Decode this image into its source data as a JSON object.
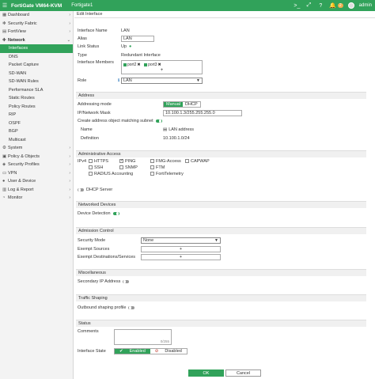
{
  "topbar": {
    "brand": "FortiGate VM64-KVM",
    "hostname": "Fortigate1",
    "notification_count": "2",
    "user": "admin"
  },
  "sidebar": {
    "items": [
      {
        "label": "Dashboard",
        "icon": "dashboard-icon",
        "chevron": "›"
      },
      {
        "label": "Security Fabric",
        "icon": "fabric-icon",
        "chevron": "›"
      },
      {
        "label": "FortiView",
        "icon": "fortiview-icon",
        "chevron": "›"
      },
      {
        "label": "Network",
        "icon": "network-icon",
        "chevron": "⌄"
      }
    ],
    "network_sub": [
      "Interfaces",
      "DNS",
      "Packet Capture",
      "SD-WAN",
      "SD-WAN Rules",
      "Performance SLA",
      "Static Routes",
      "Policy Routes",
      "RIP",
      "OSPF",
      "BGP",
      "Multicast"
    ],
    "items2": [
      {
        "label": "System",
        "icon": "system-icon",
        "chevron": "›",
        "badge": "1"
      },
      {
        "label": "Policy & Objects",
        "icon": "policy-icon",
        "chevron": "›"
      },
      {
        "label": "Security Profiles",
        "icon": "security-icon",
        "chevron": "›"
      },
      {
        "label": "VPN",
        "icon": "vpn-icon",
        "chevron": "›"
      },
      {
        "label": "User & Device",
        "icon": "user-icon",
        "chevron": "›"
      },
      {
        "label": "Log & Report",
        "icon": "log-icon",
        "chevron": "›"
      },
      {
        "label": "Monitor",
        "icon": "monitor-icon",
        "chevron": "›"
      }
    ]
  },
  "page_title": "Edit Interface",
  "form": {
    "interface_name_label": "Interface Name",
    "interface_name": "LAN",
    "alias_label": "Alias",
    "alias": "LAN",
    "link_status_label": "Link Status",
    "link_status": "Up",
    "type_label": "Type",
    "type": "Redundant Interface",
    "members_label": "Interface Members",
    "members": [
      "port2",
      "port3"
    ],
    "add_symbol": "+",
    "role_label": "Role",
    "role": "LAN"
  },
  "address": {
    "section": "Address",
    "mode_label": "Addressing mode",
    "mode_manual": "Manual",
    "mode_dhcp": "DHCP",
    "ip_label": "IP/Network Mask",
    "ip": "10.100.1.3/255.255.255.0",
    "create_label": "Create address object matching subnet",
    "name_label": "Name",
    "name": "LAN address",
    "definition_label": "Definition",
    "definition": "10.100.1.0/24"
  },
  "admin_access": {
    "section": "Administrative Access",
    "ipv4_label": "IPv4",
    "options": [
      {
        "label": "HTTPS",
        "checked": false
      },
      {
        "label": "PING",
        "checked": true
      },
      {
        "label": "FMG-Access",
        "checked": false
      },
      {
        "label": "CAPWAP",
        "checked": false
      },
      {
        "label": "SSH",
        "checked": false
      },
      {
        "label": "SNMP",
        "checked": false
      },
      {
        "label": "FTM",
        "checked": false
      },
      {
        "label": "RADIUS Accounting",
        "checked": false
      },
      {
        "label": "FortiTelemetry",
        "checked": false
      }
    ]
  },
  "dhcp_server": "DHCP Server",
  "networked_devices": {
    "section": "Networked Devices",
    "detection_label": "Device Detection"
  },
  "admission": {
    "section": "Admission Control",
    "mode_label": "Security Mode",
    "mode": "None",
    "exempt_sources_label": "Exempt Sources",
    "exempt_dest_label": "Exempt Destinations/Services",
    "add_symbol": "+"
  },
  "misc": {
    "section": "Miscellaneous",
    "secondary_label": "Secondary IP Address"
  },
  "traffic": {
    "section": "Traffic Shaping",
    "outbound_label": "Outbound shaping profile"
  },
  "status": {
    "section": "Status",
    "comments_label": "Comments",
    "comments_counter": "0/255",
    "state_label": "Interface State",
    "enabled": "Enabled",
    "disabled": "Disabled"
  },
  "buttons": {
    "ok": "OK",
    "cancel": "Cancel"
  },
  "colors": {
    "accent": "#31a25a"
  }
}
